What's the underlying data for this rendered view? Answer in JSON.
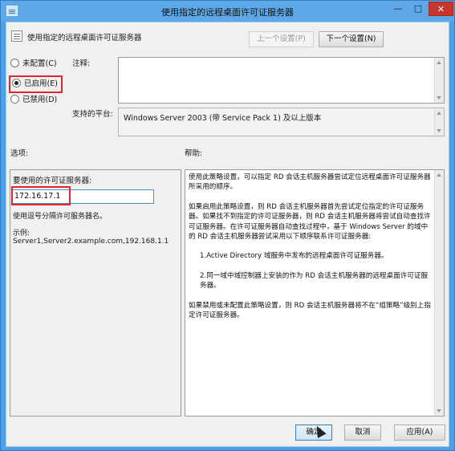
{
  "window": {
    "title": "使用指定的远程桌面许可证服务器",
    "controls": {
      "minimize": "—",
      "maximize": "□",
      "close": "✕"
    }
  },
  "header": {
    "policy_title": "使用指定的远程桌面许可证服务器",
    "prev_button": "上一个设置(P)",
    "next_button": "下一个设置(N)"
  },
  "state": {
    "options": [
      {
        "label": "未配置(C)",
        "checked": false
      },
      {
        "label": "已启用(E)",
        "checked": true
      },
      {
        "label": "已禁用(D)",
        "checked": false
      }
    ]
  },
  "comment": {
    "label": "注释:",
    "value": ""
  },
  "platform": {
    "label": "支持的平台:",
    "value": "Windows Server 2003 (带 Service Pack 1) 及以上版本"
  },
  "options_panel": {
    "label": "选项:",
    "server_label": "要使用的许可证服务器:",
    "server_value": "172.16.17.1",
    "hint": "使用逗号分隔许可服务器名。",
    "example_label": "示例:",
    "example_value": "Server1,Server2.example.com,192.168.1.1"
  },
  "help_panel": {
    "label": "帮助:",
    "paragraphs": [
      "使用此策略设置，可以指定 RD 会话主机服务器尝试定位远程桌面许可证服务器所采用的顺序。",
      "如果启用此策略设置，则 RD 会话主机服务器首先尝试定位指定的许可证服务器。如果找不到指定的许可证服务器，则 RD 会话主机服务器将尝试自动查找许可证服务器。在许可证服务器自动查找过程中，基于 Windows Server 的域中的 RD 会话主机服务器尝试采用以下顺序联系许可证服务器:",
      "1.Active Directory 域服务中发布的远程桌面许可证服务器。",
      "2.同一域中域控制器上安装的作为 RD 会话主机服务器的远程桌面许可证服务器。",
      "如果禁用或未配置此策略设置，则 RD 会话主机服务器将不在“组策略”级别上指定许可证服务器。"
    ]
  },
  "footer": {
    "ok_button": "确定",
    "cancel_button": "取消",
    "apply_button": "应用(A)"
  },
  "colors": {
    "titlebar": "#5fa8e8",
    "close_button": "#c7362c",
    "highlight_box": "#e3262a"
  }
}
